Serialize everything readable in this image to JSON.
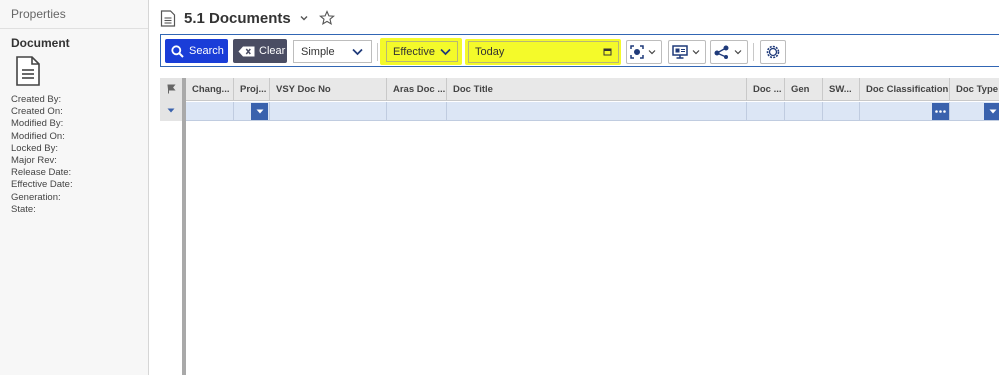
{
  "left_panel": {
    "tab_label": "Properties",
    "heading": "Document",
    "doc_icon": "document-icon",
    "fields": [
      "Created By:",
      "Created On:",
      "Modified By:",
      "Modified On:",
      "Locked By:",
      "Major Rev:",
      "Release Date:",
      "Effective Date:",
      "Generation:",
      "State:"
    ]
  },
  "header": {
    "title": "5.1 Documents",
    "title_icon": "document-icon",
    "dropdown_icon": "chevron-down-icon",
    "favorite_icon": "star-icon"
  },
  "toolbar": {
    "search_label": "Search",
    "clear_label": "Clear",
    "search_mode": "Simple",
    "effectivity_mode": "Effective",
    "effectivity_date": "Today",
    "highlight_color": "#f4fa2a",
    "search_button_color": "#1a3dd8",
    "clear_button_color": "#4a4d63",
    "icons": [
      "target-icon",
      "monitor-icon",
      "share-icon",
      "settings-icon"
    ]
  },
  "grid": {
    "columns": [
      "Chang...",
      "Proj...",
      "VSY Doc No",
      "Aras Doc ...",
      "Doc Title",
      "Doc ...",
      "Gen",
      "SW...",
      "Doc Classification",
      "Doc Type"
    ],
    "flag_icon": "flag-icon",
    "filter_row_color": "#dce6f5"
  }
}
